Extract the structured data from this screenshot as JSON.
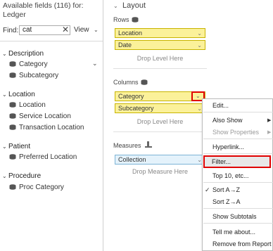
{
  "left_panel": {
    "available_title": "Available fields (116) for: Ledger",
    "find_label": "Find:",
    "find_value": "cat",
    "clear_icon": "close-icon",
    "view_label": "View",
    "groups": [
      {
        "label": "Description",
        "fields": [
          "Category",
          "Subcategory"
        ]
      },
      {
        "label": "Location",
        "fields": [
          "Location",
          "Service Location",
          "Transaction Location"
        ]
      },
      {
        "label": "Patient",
        "fields": [
          "Preferred Location"
        ]
      },
      {
        "label": "Procedure",
        "fields": [
          "Proc Category"
        ]
      }
    ]
  },
  "layout": {
    "title": "Layout",
    "rows_label": "Rows",
    "rows": [
      "Location",
      "Date"
    ],
    "rows_drop": "Drop Level Here",
    "columns_label": "Columns",
    "columns": [
      "Category",
      "Subcategory"
    ],
    "columns_drop": "Drop Level Here",
    "measures_label": "Measures",
    "measures": [
      "Collection"
    ],
    "measures_drop": "Drop Measure Here"
  },
  "context_menu": {
    "items": [
      {
        "label": "Edit...",
        "disabled": false
      },
      {
        "label": "Also Show",
        "disabled": false,
        "submenu": true
      },
      {
        "label": "Show Properties",
        "disabled": true,
        "submenu": true
      },
      {
        "label": "Hyperlink...",
        "disabled": false
      },
      {
        "label": "Filter...",
        "disabled": false,
        "highlighted": true
      },
      {
        "label": "Top 10, etc...",
        "disabled": false
      },
      {
        "label": "Sort A→Z",
        "disabled": false,
        "checked": true
      },
      {
        "label": "Sort Z→A",
        "disabled": false
      },
      {
        "label": "Show Subtotals",
        "disabled": false
      },
      {
        "label": "Tell me about...",
        "disabled": false
      },
      {
        "label": "Remove from Report",
        "disabled": false
      }
    ]
  },
  "colors": {
    "pill_yellow": "#fbf19a",
    "pill_blue": "#e4f2fb",
    "highlight_red": "#e00000"
  }
}
